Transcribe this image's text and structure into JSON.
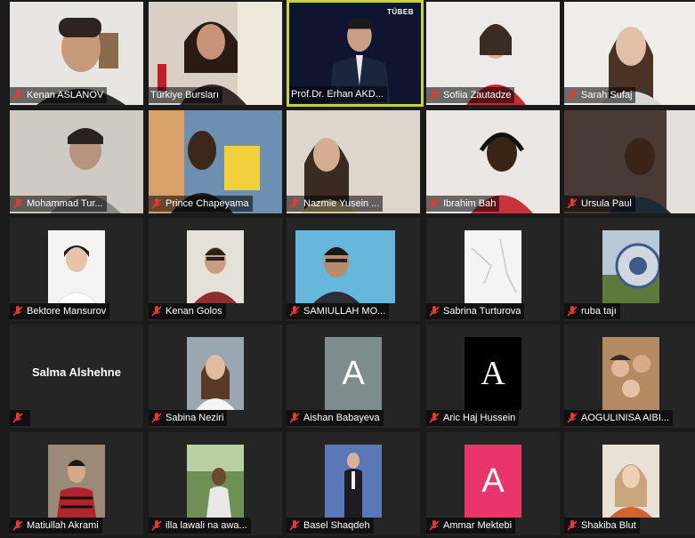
{
  "participants": [
    {
      "name": "Kenan ASLANOV"
    },
    {
      "name": "Türkiye Bursları"
    },
    {
      "name": "Prof.Dr. Erhan AKD...",
      "logo": "TÜBEB"
    },
    {
      "name": "Sofiia Zautadze"
    },
    {
      "name": "Sarah Sufaj"
    },
    {
      "name": "Mohammad Tur..."
    },
    {
      "name": "Prince Chapeyama"
    },
    {
      "name": "Nazmie Yusein ..."
    },
    {
      "name": "Ibrahim Bah"
    },
    {
      "name": "Ursula Paul"
    },
    {
      "name": "Bektore Mansurov"
    },
    {
      "name": "Kenan Golos"
    },
    {
      "name": "SAMIULLAH MO..."
    },
    {
      "name": "Sabrina Turturova"
    },
    {
      "name": "ruba tajı"
    },
    {
      "name": "",
      "center_name": "Salma Alshehne"
    },
    {
      "name": "Sabina Neziri"
    },
    {
      "name": "Aishan Babayeva",
      "letter": "A"
    },
    {
      "name": "Aric Haj Hussein",
      "letter": "A"
    },
    {
      "name": "AOGULINISA AIBI..."
    },
    {
      "name": "Matiullah Akrami"
    },
    {
      "name": "illa lawali na awa..."
    },
    {
      "name": "Basel Shaqdeh"
    },
    {
      "name": "Ammar Mektebi",
      "letter": "A"
    },
    {
      "name": "Shakiba Blut"
    }
  ],
  "colors": {
    "background": "#1a1a1a",
    "tile": "#252525",
    "active_speaker_border": "#c8d23c",
    "muted_mic": "#e53935"
  },
  "icons": {
    "muted": "mic-muted-icon"
  }
}
